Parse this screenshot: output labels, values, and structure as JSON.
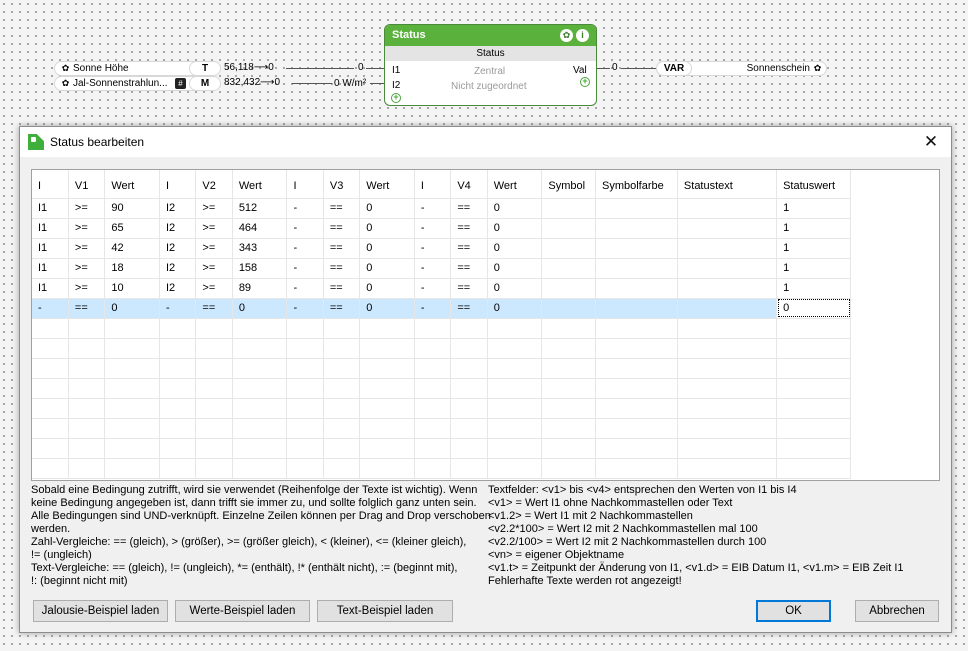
{
  "canvas": {
    "inputs": [
      {
        "label": "Sonne Höhe",
        "badge": "T",
        "value": "56,118",
        "arrow_value": "0"
      },
      {
        "label": "Jal-Sonnenstrahlun...",
        "hash": "#",
        "badge": "M",
        "value": "832,432",
        "arrow_value": "0"
      }
    ],
    "wire_values": [
      "0",
      "0 W/m²"
    ],
    "status_node": {
      "title": "Status",
      "subtitle": "Status",
      "port_i1": "I1",
      "port_i2": "I2",
      "center_1": "Zentral",
      "center_2": "Nicht zugeordnet",
      "output_label": "Val",
      "output_value": "0"
    },
    "output": {
      "badge": "VAR",
      "label": "Sonnenschein"
    }
  },
  "dialog": {
    "title": "Status bearbeiten",
    "close_glyph": "✕",
    "columns": [
      "I",
      "V1",
      "Wert",
      "I",
      "V2",
      "Wert",
      "I",
      "V3",
      "Wert",
      "I",
      "V4",
      "Wert",
      "Symbol",
      "Symbolfarbe",
      "Statustext",
      "Statuswert"
    ],
    "rows": [
      [
        "I1",
        ">=",
        "90",
        "I2",
        ">=",
        "512",
        "-",
        "==",
        "0",
        "-",
        "==",
        "0",
        "",
        "",
        "",
        "1"
      ],
      [
        "I1",
        ">=",
        "65",
        "I2",
        ">=",
        "464",
        "-",
        "==",
        "0",
        "-",
        "==",
        "0",
        "",
        "",
        "",
        "1"
      ],
      [
        "I1",
        ">=",
        "42",
        "I2",
        ">=",
        "343",
        "-",
        "==",
        "0",
        "-",
        "==",
        "0",
        "",
        "",
        "",
        "1"
      ],
      [
        "I1",
        ">=",
        "18",
        "I2",
        ">=",
        "158",
        "-",
        "==",
        "0",
        "-",
        "==",
        "0",
        "",
        "",
        "",
        "1"
      ],
      [
        "I1",
        ">=",
        "10",
        "I2",
        ">=",
        "89",
        "-",
        "==",
        "0",
        "-",
        "==",
        "0",
        "",
        "",
        "",
        "1"
      ],
      [
        "-",
        "==",
        "0",
        "-",
        "==",
        "0",
        "-",
        "==",
        "0",
        "-",
        "==",
        "0",
        "",
        "",
        "",
        "0"
      ]
    ],
    "help_left": [
      "Sobald eine Bedingung zutrifft, wird sie verwendet (Reihenfolge der Texte ist wichtig). Wenn",
      "keine Bedingung angegeben ist, dann trifft sie immer zu, und sollte folglich ganz unten sein.",
      "Alle Bedingungen sind UND-verknüpft. Einzelne Zeilen können per Drag and Drop verschoben",
      "werden.",
      "Zahl-Vergleiche: == (gleich), > (größer), >= (größer gleich), < (kleiner), <= (kleiner gleich),",
      "!= (ungleich)",
      "Text-Vergleiche: == (gleich), != (ungleich), *= (enthält), !* (enthält nicht), := (beginnt mit),",
      "!: (beginnt nicht mit)"
    ],
    "help_right": [
      "Textfelder: <v1> bis <v4> entsprechen den Werten von I1 bis I4",
      "<v1> = Wert I1 ohne Nachkommastellen oder Text",
      "<v1.2> = Wert I1 mit 2 Nachkommastellen",
      "<v2.2*100> = Wert I2 mit 2 Nachkommastellen mal 100",
      "<v2.2/100> = Wert I2 mit 2 Nachkommastellen durch 100",
      "<vn> = eigener Objektname",
      "<v1.t> = Zeitpunkt der Änderung von I1, <v1.d> = EIB Datum I1, <v1.m> = EIB Zeit I1",
      "Fehlerhafte Texte werden rot angezeigt!"
    ],
    "buttons": {
      "jalousie": "Jalousie-Beispiel laden",
      "werte": "Werte-Beispiel laden",
      "text": "Text-Beispiel laden",
      "ok": "OK",
      "cancel": "Abbrechen"
    }
  },
  "colors": {
    "node_green": "#5ab13c",
    "selection": "#cce8ff",
    "default_button_border": "#0078d7"
  }
}
